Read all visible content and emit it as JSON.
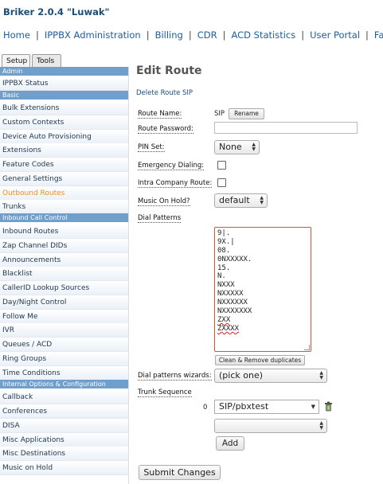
{
  "app": {
    "title": "Briker 2.0.4 \"Luwak\""
  },
  "topnav": [
    "Home",
    "IPPBX Administration",
    "Billing",
    "CDR",
    "ACD Statistics",
    "User Portal",
    "Fax"
  ],
  "tabs": [
    "Setup",
    "Tools"
  ],
  "sidebar": {
    "sections": [
      "Admin",
      "Basic",
      "Inbound Call Control",
      "Internal Options & Configuration"
    ],
    "items": [
      "IPPBX Status",
      "Bulk Extensions",
      "Custom Contexts",
      "Device Auto Provisioning",
      "Extensions",
      "Feature Codes",
      "General Settings",
      "Outbound Routes",
      "Trunks",
      "Inbound Routes",
      "Zap Channel DIDs",
      "Announcements",
      "Blacklist",
      "CallerID Lookup Sources",
      "Day/Night Control",
      "Follow Me",
      "IVR",
      "Queues / ACD",
      "Ring Groups",
      "Time Conditions",
      "Callback",
      "Conferences",
      "DISA",
      "Misc Applications",
      "Misc Destinations",
      "Music on Hold"
    ],
    "selected": "Outbound Routes"
  },
  "form": {
    "title": "Edit Route",
    "delete_link": "Delete Route SIP",
    "route_name_label": "Route Name:",
    "route_name_value": "SIP",
    "rename_button": "Rename",
    "route_password_label": "Route Password:",
    "route_password_value": "",
    "pin_set_label": "PIN Set:",
    "pin_set_value": "None",
    "emergency_label": "Emergency Dialing:",
    "emergency_checked": false,
    "intra_company_label": "Intra Company Route:",
    "intra_company_checked": false,
    "moh_label": "Music On Hold?",
    "moh_value": "default",
    "dial_patterns_label": "Dial Patterns",
    "dial_patterns": [
      "9|.",
      "9X.|",
      "08.",
      "0NXXXXX.",
      "15.",
      "N.",
      "NXXX",
      "NXXXXX",
      "NXXXXXX",
      "NXXXXXXX",
      "ZXX",
      "ZXXXX"
    ],
    "clean_button": "Clean & Remove duplicates",
    "wizards_label": "Dial patterns wizards:",
    "wizards_value": "(pick one)",
    "trunk_sequence_label": "Trunk Sequence",
    "trunk_index": "0",
    "trunk_value": "SIP/pbxtest",
    "trunk_empty_value": "",
    "add_button": "Add",
    "submit_button": "Submit Changes"
  },
  "colors": {
    "accent": "#6f9fcc",
    "selected": "#f08c19",
    "error_border": "#d4572f",
    "link": "#1a5fa0"
  }
}
